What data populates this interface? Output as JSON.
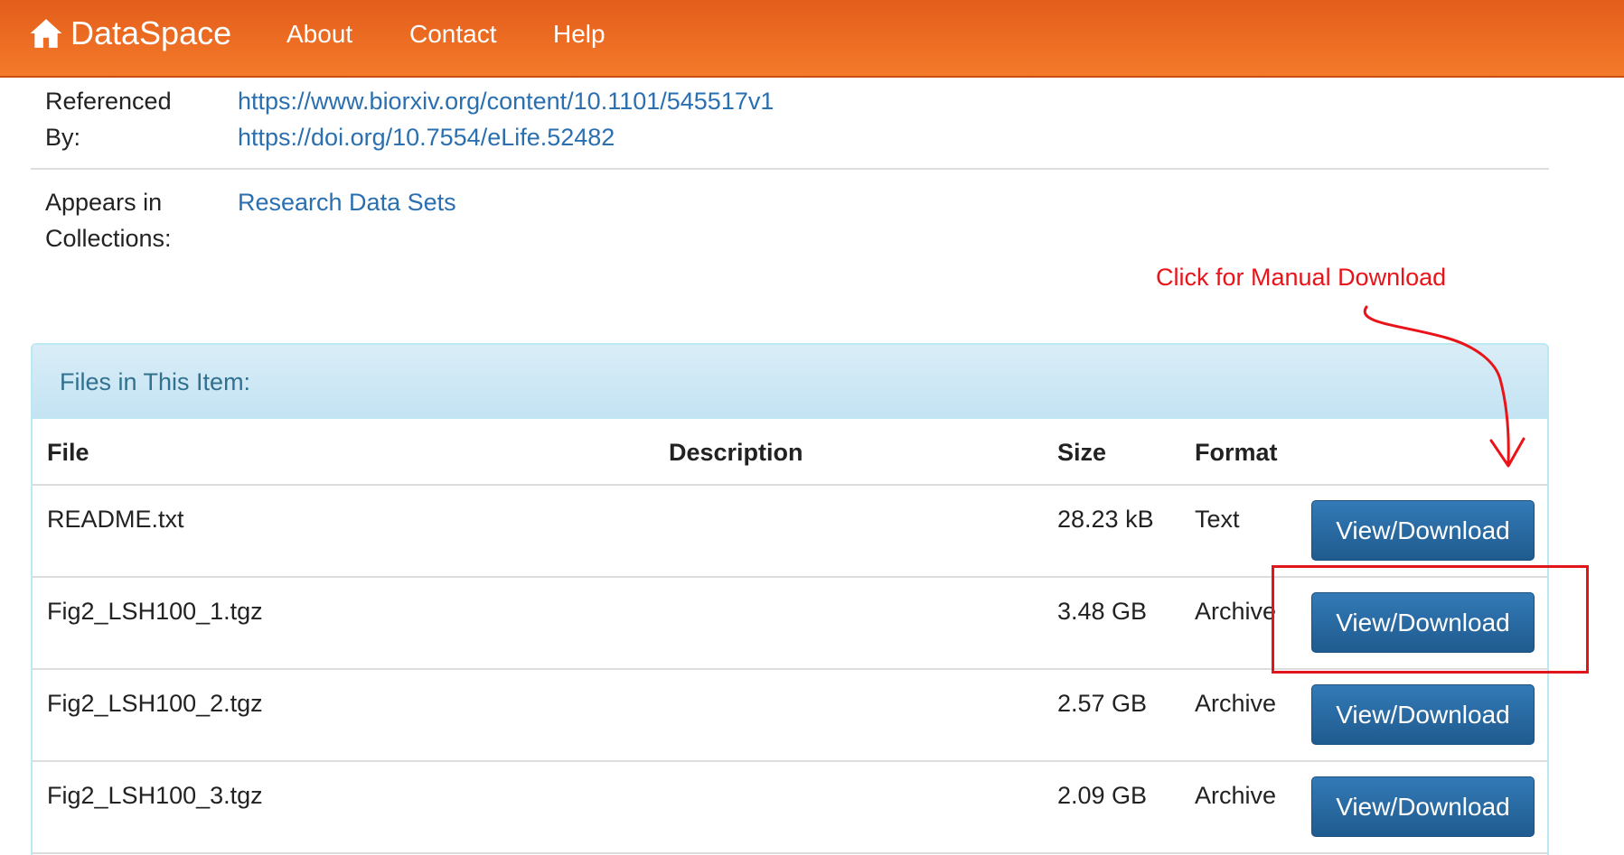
{
  "navbar": {
    "brand": "DataSpace",
    "links": [
      "About",
      "Contact",
      "Help"
    ]
  },
  "metadata": {
    "referenced_by": {
      "label_line1": "Referenced",
      "label_line2": "By:",
      "links": [
        "https://www.biorxiv.org/content/10.1101/545517v1",
        "https://doi.org/10.7554/eLife.52482"
      ]
    },
    "collections": {
      "label_line1": "Appears in",
      "label_line2": "Collections:",
      "links": [
        "Research Data Sets"
      ]
    }
  },
  "annotation": {
    "text": "Click for Manual Download",
    "color": "#e8141a"
  },
  "files_panel": {
    "title": "Files in This Item:",
    "columns": [
      "File",
      "Description",
      "Size",
      "Format"
    ],
    "rows": [
      {
        "file": "README.txt",
        "description": "",
        "size": "28.23 kB",
        "format": "Text",
        "action": "View/Download"
      },
      {
        "file": "Fig2_LSH100_1.tgz",
        "description": "",
        "size": "3.48 GB",
        "format": "Archive",
        "action": "View/Download"
      },
      {
        "file": "Fig2_LSH100_2.tgz",
        "description": "",
        "size": "2.57 GB",
        "format": "Archive",
        "action": "View/Download"
      },
      {
        "file": "Fig2_LSH100_3.tgz",
        "description": "",
        "size": "2.09 GB",
        "format": "Archive",
        "action": "View/Download"
      }
    ]
  },
  "colors": {
    "navbar": "#f47a2a",
    "link": "#2a6fb0",
    "panel_heading": "#d9edf7",
    "button": "#337ab7"
  }
}
